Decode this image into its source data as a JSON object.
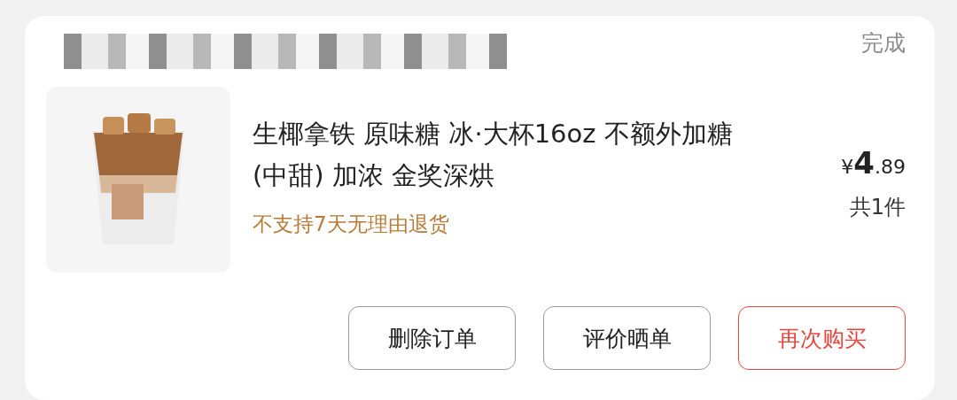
{
  "header": {
    "action": "完成"
  },
  "product": {
    "title": "生椰拿铁 原味糖 冰·大杯16oz 不额外加糖(中甜) 加浓 金奖深烘",
    "notice": "不支持7天无理由退货",
    "price": {
      "currency": "¥",
      "integer": "4",
      "decimal": ".89"
    },
    "quantity": "共1件"
  },
  "buttons": [
    {
      "label": "删除订单",
      "kind": "outline"
    },
    {
      "label": "评价晒单",
      "kind": "outline"
    },
    {
      "label": "再次购买",
      "kind": "accent"
    }
  ]
}
